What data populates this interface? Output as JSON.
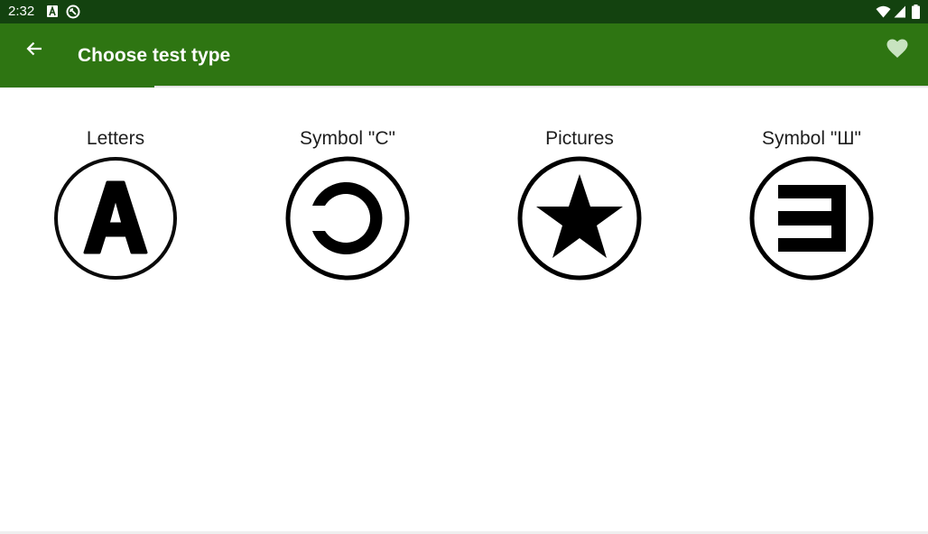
{
  "status_bar": {
    "time": "2:32",
    "icons": [
      "a-notification-icon",
      "sync-notification-icon",
      "wifi-icon",
      "signal-icon",
      "battery-icon"
    ]
  },
  "app_bar": {
    "title": "Choose test type",
    "back_icon": "arrow-back-icon",
    "favorite_icon": "heart-icon"
  },
  "colors": {
    "status_bar": "#13420f",
    "app_bar": "#2e7512",
    "background": "#ffffff",
    "icon_fill": "#000000"
  },
  "options": [
    {
      "label": "Letters",
      "icon": "letter-a-icon"
    },
    {
      "label": "Symbol \"C\"",
      "icon": "landolt-c-icon"
    },
    {
      "label": "Pictures",
      "icon": "star-icon"
    },
    {
      "label": "Symbol \"Ш\"",
      "icon": "tumbling-e-icon"
    }
  ]
}
